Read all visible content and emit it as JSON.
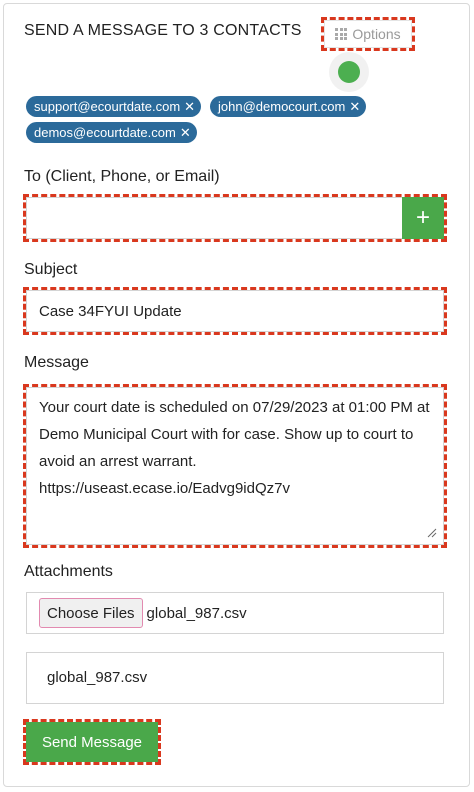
{
  "header": {
    "title": "SEND A MESSAGE TO 3 CONTACTS",
    "options_label": "Options"
  },
  "recipients": [
    {
      "email": "support@ecourtdate.com",
      "remove": "✕"
    },
    {
      "email": "john@democourt.com",
      "remove": "✕"
    },
    {
      "email": "demos@ecourtdate.com",
      "remove": "✕"
    }
  ],
  "to_field": {
    "label": "To (Client, Phone, or Email)",
    "value": "",
    "add_label": "+"
  },
  "subject_field": {
    "label": "Subject",
    "value": "Case 34FYUI Update"
  },
  "message_field": {
    "label": "Message",
    "value": "Your court date is scheduled on 07/29/2023 at 01:00 PM at Demo Municipal Court with for case. Show up to court to avoid an arrest warrant. https://useast.ecase.io/Eadvg9idQz7v"
  },
  "attachments": {
    "label": "Attachments",
    "choose_label": "Choose Files",
    "selected_file": "global_987.csv",
    "files": [
      "global_987.csv"
    ]
  },
  "send_label": "Send Message",
  "colors": {
    "chip": "#2b6a9a",
    "primary_green": "#4aa84a",
    "status_dot": "#4caf50"
  }
}
